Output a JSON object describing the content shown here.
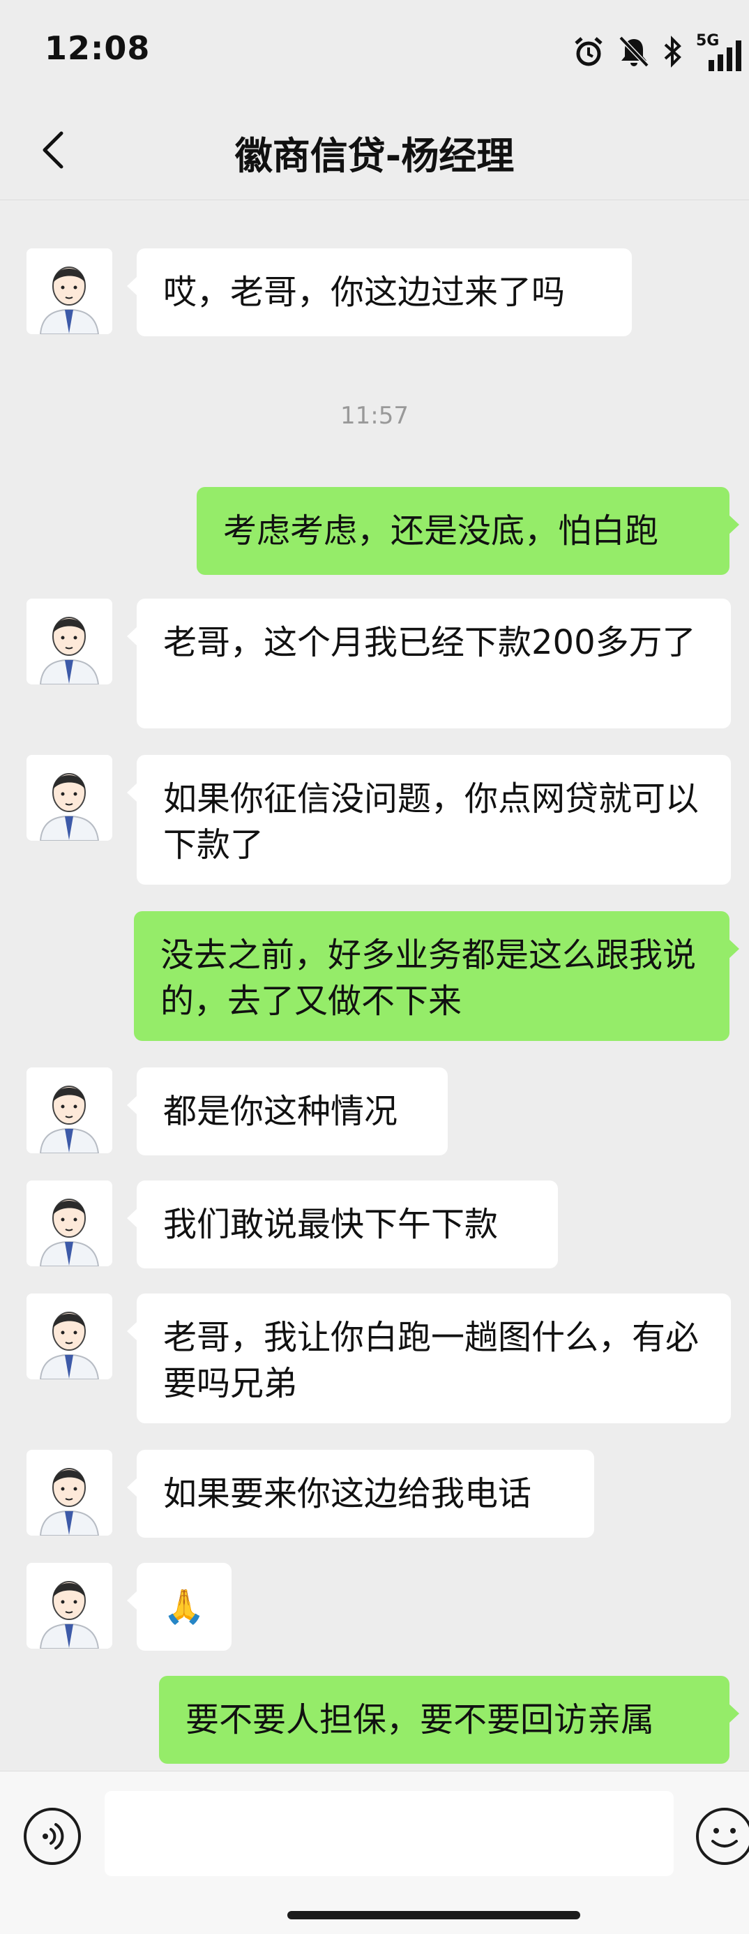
{
  "status_bar": {
    "time": "12:08",
    "network": "5G"
  },
  "header": {
    "title": "徽商信贷-杨经理",
    "back_icon": "chevron-left-icon"
  },
  "chat": {
    "time_divider": "11:57",
    "messages": [
      {
        "side": "left",
        "text": "哎，老哥，你这边过来了吗"
      },
      {
        "side": "right",
        "text": "考虑考虑，还是没底，怕白跑"
      },
      {
        "side": "left",
        "text": "老哥，这个月我已经下款200多万了"
      },
      {
        "side": "left",
        "text": "如果你征信没问题，你点网贷就可以下款了"
      },
      {
        "side": "right",
        "text": "没去之前，好多业务都是这么跟我说的，去了又做不下来"
      },
      {
        "side": "left",
        "text": "都是你这种情况"
      },
      {
        "side": "left",
        "text": "我们敢说最快下午下款"
      },
      {
        "side": "left",
        "text": "老哥，我让你白跑一趟图什么，有必要吗兄弟"
      },
      {
        "side": "left",
        "text": "如果要来你这边给我电话"
      },
      {
        "side": "left",
        "text": "🙏"
      },
      {
        "side": "right",
        "text": "要不要人担保，要不要回访亲属"
      }
    ]
  },
  "input_bar": {
    "voice_icon": "voice-icon",
    "emoji_icon": "emoji-icon"
  },
  "colors": {
    "sent_bubble": "#95ec69",
    "received_bubble": "#ffffff",
    "background": "#ededed"
  }
}
